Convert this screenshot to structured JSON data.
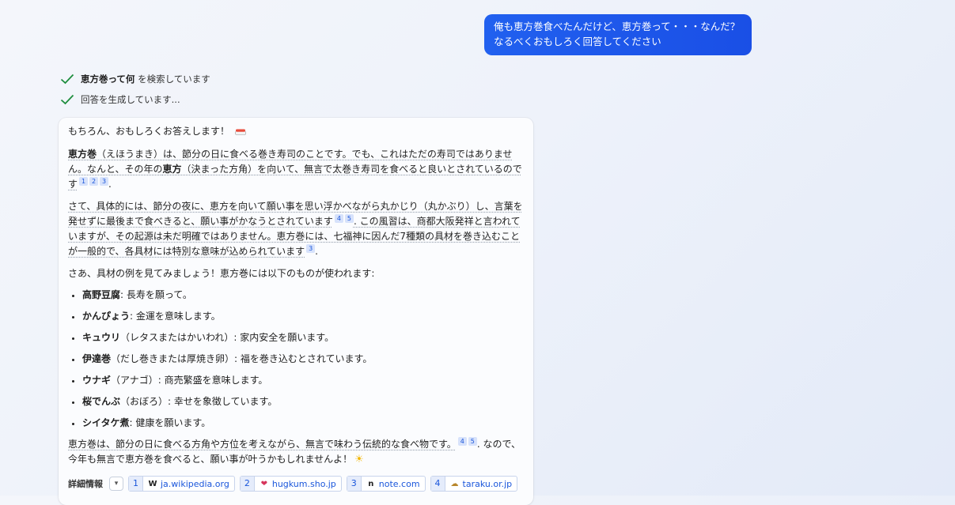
{
  "user_message": {
    "line1": "俺も恵方巻食べたんだけど、恵方巻って・・・なんだ？",
    "line2": "なるべくおもしろく回答してください"
  },
  "status": {
    "search_query": "恵方巻って何",
    "search_suffix": " を検索しています",
    "generating": "回答を生成しています..."
  },
  "answer": {
    "greeting": "もちろん、おもしろくお答えします！",
    "p1": {
      "term": "恵方巻",
      "t1": "（えほうまき）は、節分の日に食べる巻き寿司のことです。でも、これはただの寿司ではありません。なんと、その年の",
      "term2": "恵方",
      "t2": "（決まった方角）を向いて、無言で太巻き寿司を食べると良いとされているのです",
      "refs": [
        "1",
        "2",
        "3"
      ],
      "end": "."
    },
    "p2": {
      "t1": "さて、具体的には、節分の夜に、恵方を向いて願い事を思い浮かべながら丸かじり（丸かぶり）し、言葉を発せずに最後まで食べきると、願い事がかなうとされています",
      "refs1": [
        "4",
        "5"
      ],
      "t2": ". この風習は、商都大阪発祥と言われていますが、その起源は未だ明確ではありません。恵方巻には、七福神に因んだ7種類の具材を巻き込むことが一般的で、各具材には特別な意味が込められています",
      "refs2": [
        "3"
      ],
      "end": "."
    },
    "p3": "さあ、具材の例を見てみましょう！恵方巻には以下のものが使われます:",
    "ingredients": [
      {
        "name": "高野豆腐",
        "desc": ": 長寿を願って。"
      },
      {
        "name": "かんぴょう",
        "desc": ": 金運を意味します。"
      },
      {
        "name": "キュウリ",
        "desc": "（レタスまたはかいわれ）: 家内安全を願います。"
      },
      {
        "name": "伊達巻",
        "desc": "（だし巻きまたは厚焼き卵）: 福を巻き込むとされています。"
      },
      {
        "name": "ウナギ",
        "desc": "（アナゴ）: 商売繁盛を意味します。"
      },
      {
        "name": "桜でんぶ",
        "desc": "（おぼろ）: 幸せを象徴しています。"
      },
      {
        "name": "シイタケ煮",
        "desc": ": 健康を願います。"
      }
    ],
    "p4": {
      "t1": "恵方巻は、節分の日に食べる方角や方位を考えながら、無言で味わう伝統的な食べ物です。",
      "refs": [
        "4",
        "5"
      ],
      "t2": ". なので、今年も無言で恵方巻を食べると、願い事が叶うかもしれませんよ！"
    }
  },
  "footer": {
    "label": "詳細情報",
    "sources": [
      {
        "num": "1",
        "fav": "W",
        "host": "ja.wikipedia.org"
      },
      {
        "num": "2",
        "fav": "❤",
        "host": "hugkum.sho.jp"
      },
      {
        "num": "3",
        "fav": "n",
        "host": "note.com"
      },
      {
        "num": "4",
        "fav": "☁",
        "host": "taraku.or.jp"
      }
    ]
  },
  "colors": {
    "user_bubble": "#1a4fe6",
    "check": "#1e8e3e",
    "link": "#1a56db"
  },
  "icons": [
    "check-icon",
    "sushi-icon",
    "sun-icon",
    "chevron-down-icon"
  ]
}
